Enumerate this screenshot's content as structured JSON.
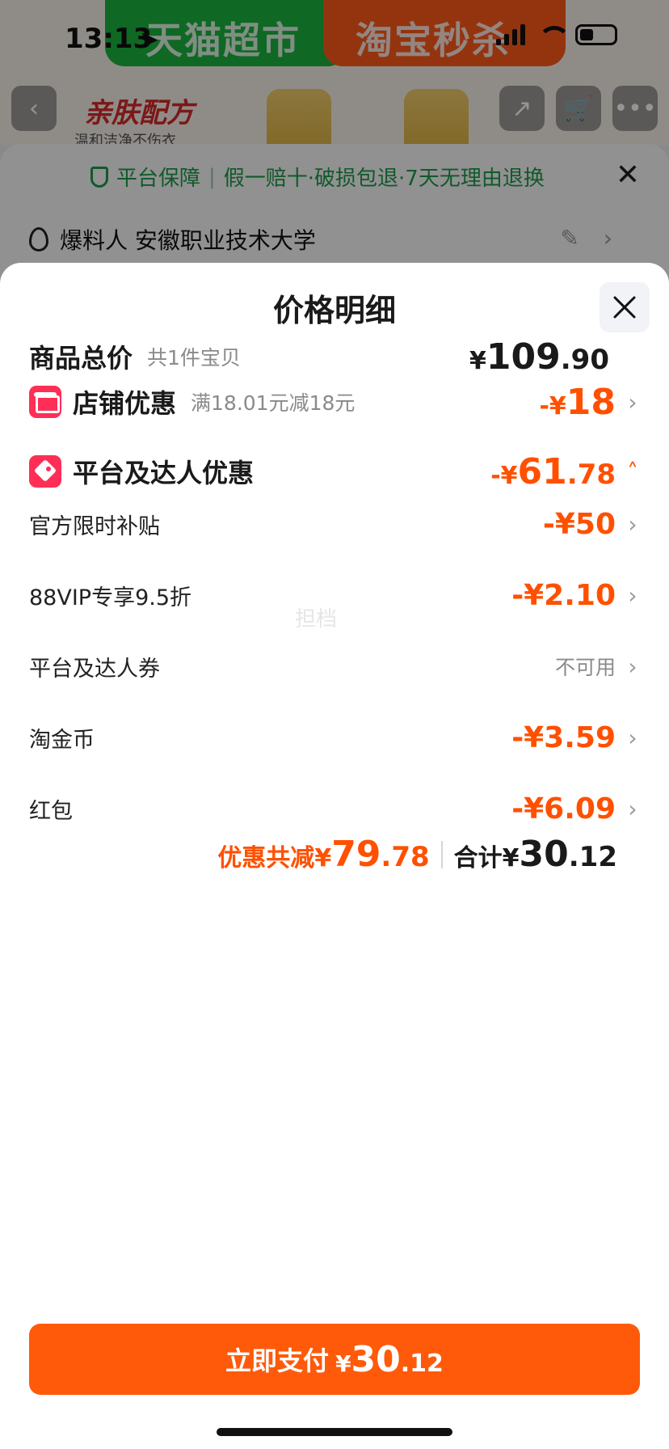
{
  "status_bar": {
    "time": "13:13"
  },
  "background": {
    "banner_left": "天猫超市",
    "banner_right": "淘宝秒杀",
    "promo_title": "亲肤配方",
    "promo_sub": "温和洁净不伤衣",
    "guarantee_title": "平台保障",
    "guarantee_text": "假一赔十·破损包退·7天无理由退换",
    "address": "爆料人 安徽职业技术大学"
  },
  "sheet": {
    "title": "价格明细",
    "total": {
      "label": "商品总价",
      "sub": "共1件宝贝",
      "currency": "¥",
      "integer": "109",
      "decimal": ".90"
    },
    "store_discount": {
      "label": "店铺优惠",
      "sub": "满18.01元减18元",
      "prefix": "-¥",
      "value": "18"
    },
    "platform_discount": {
      "label": "平台及达人优惠",
      "prefix": "-¥",
      "integer": "61",
      "decimal": ".78"
    },
    "items": [
      {
        "label": "官方限时补贴",
        "value": "-¥50"
      },
      {
        "label": "88VIP专享9.5折",
        "value": "-¥2.10"
      },
      {
        "label": "平台及达人券",
        "value": "不可用"
      },
      {
        "label": "淘金币",
        "value": "-¥3.59"
      },
      {
        "label": "红包",
        "value": "-¥6.09"
      }
    ],
    "watermark": "担档",
    "summary": {
      "discount_label": "优惠共减",
      "discount_currency": "¥",
      "discount_integer": "79",
      "discount_decimal": ".78",
      "total_label": "合计",
      "total_currency": "¥",
      "total_integer": "30",
      "total_decimal": ".12"
    },
    "pay_button": {
      "label": "立即支付",
      "currency": "¥",
      "integer": "30",
      "decimal": ".12"
    }
  },
  "colors": {
    "accent": "#ff5000",
    "button": "#ff5a0a",
    "badge": "#ff2e56",
    "guarantee": "#1e9a4a"
  }
}
